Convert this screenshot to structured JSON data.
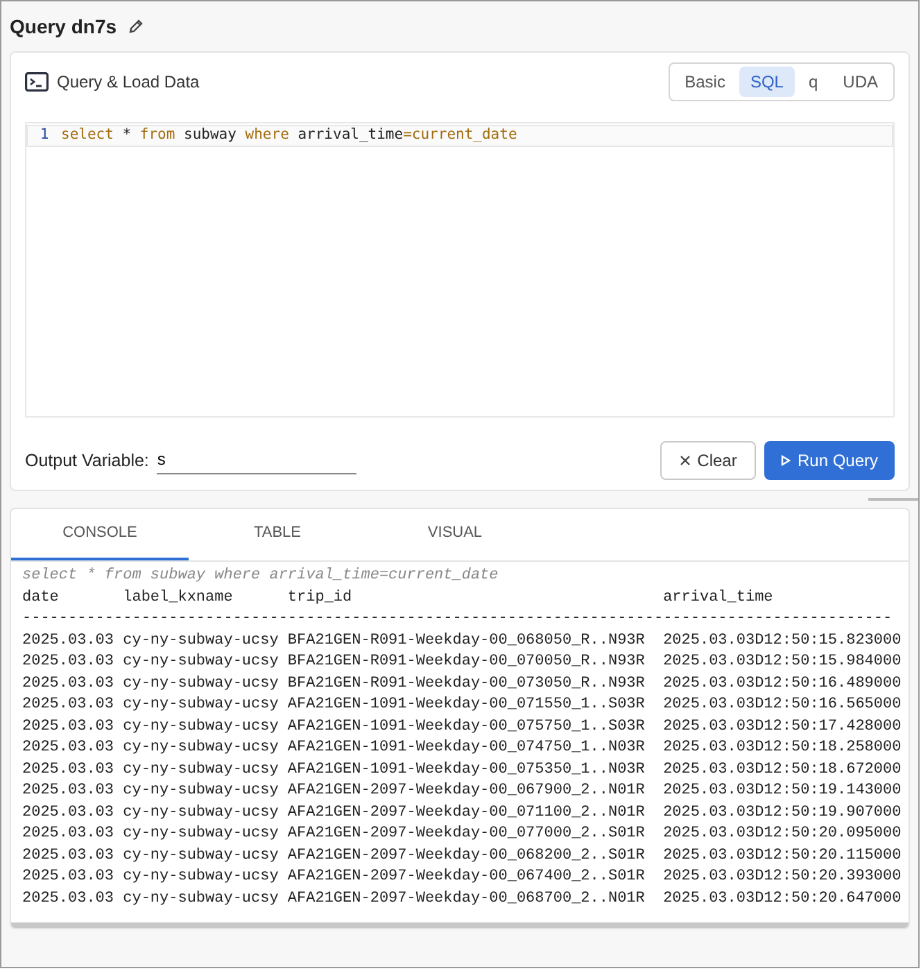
{
  "title": "Query dn7s",
  "query_panel": {
    "title": "Query & Load Data",
    "modes": [
      {
        "label": "Basic",
        "selected": false
      },
      {
        "label": "SQL",
        "selected": true
      },
      {
        "label": "q",
        "selected": false
      },
      {
        "label": "UDA",
        "selected": false
      }
    ],
    "editor": {
      "line_number": "1",
      "tokens": [
        {
          "text": "select",
          "kind": "keyword"
        },
        {
          "text": " * ",
          "kind": "plain"
        },
        {
          "text": "from",
          "kind": "keyword"
        },
        {
          "text": " subway ",
          "kind": "plain"
        },
        {
          "text": "where",
          "kind": "keyword"
        },
        {
          "text": " arrival_time",
          "kind": "plain"
        },
        {
          "text": "=",
          "kind": "keyword"
        },
        {
          "text": "current_date",
          "kind": "keyword"
        }
      ]
    },
    "output_variable": {
      "label": "Output Variable:",
      "value": "s"
    },
    "buttons": [
      {
        "label": "Clear",
        "kind": "secondary"
      },
      {
        "label": "Run Query",
        "kind": "primary"
      }
    ]
  },
  "results": {
    "tabs": [
      {
        "label": "CONSOLE",
        "selected": true
      },
      {
        "label": "TABLE",
        "selected": false
      },
      {
        "label": "VISUAL",
        "selected": false
      }
    ],
    "console": {
      "echo": "select * from subway where arrival_time=current_date",
      "lines": [
        "date       label_kxname      trip_id                                  arrival_time",
        "-----------------------------------------------------------------------------------------------",
        "2025.03.03 cy-ny-subway-ucsy BFA21GEN-R091-Weekday-00_068050_R..N93R  2025.03.03D12:50:15.823000",
        "2025.03.03 cy-ny-subway-ucsy BFA21GEN-R091-Weekday-00_070050_R..N93R  2025.03.03D12:50:15.984000",
        "2025.03.03 cy-ny-subway-ucsy BFA21GEN-R091-Weekday-00_073050_R..N93R  2025.03.03D12:50:16.489000",
        "2025.03.03 cy-ny-subway-ucsy AFA21GEN-1091-Weekday-00_071550_1..S03R  2025.03.03D12:50:16.565000",
        "2025.03.03 cy-ny-subway-ucsy AFA21GEN-1091-Weekday-00_075750_1..S03R  2025.03.03D12:50:17.428000",
        "2025.03.03 cy-ny-subway-ucsy AFA21GEN-1091-Weekday-00_074750_1..N03R  2025.03.03D12:50:18.258000",
        "2025.03.03 cy-ny-subway-ucsy AFA21GEN-1091-Weekday-00_075350_1..N03R  2025.03.03D12:50:18.672000",
        "2025.03.03 cy-ny-subway-ucsy AFA21GEN-2097-Weekday-00_067900_2..N01R  2025.03.03D12:50:19.143000",
        "2025.03.03 cy-ny-subway-ucsy AFA21GEN-2097-Weekday-00_071100_2..N01R  2025.03.03D12:50:19.907000",
        "2025.03.03 cy-ny-subway-ucsy AFA21GEN-2097-Weekday-00_077000_2..S01R  2025.03.03D12:50:20.095000",
        "2025.03.03 cy-ny-subway-ucsy AFA21GEN-2097-Weekday-00_068200_2..S01R  2025.03.03D12:50:20.115000",
        "2025.03.03 cy-ny-subway-ucsy AFA21GEN-2097-Weekday-00_067400_2..S01R  2025.03.03D12:50:20.393000",
        "2025.03.03 cy-ny-subway-ucsy AFA21GEN-2097-Weekday-00_068700_2..N01R  2025.03.03D12:50:20.647000"
      ]
    }
  }
}
